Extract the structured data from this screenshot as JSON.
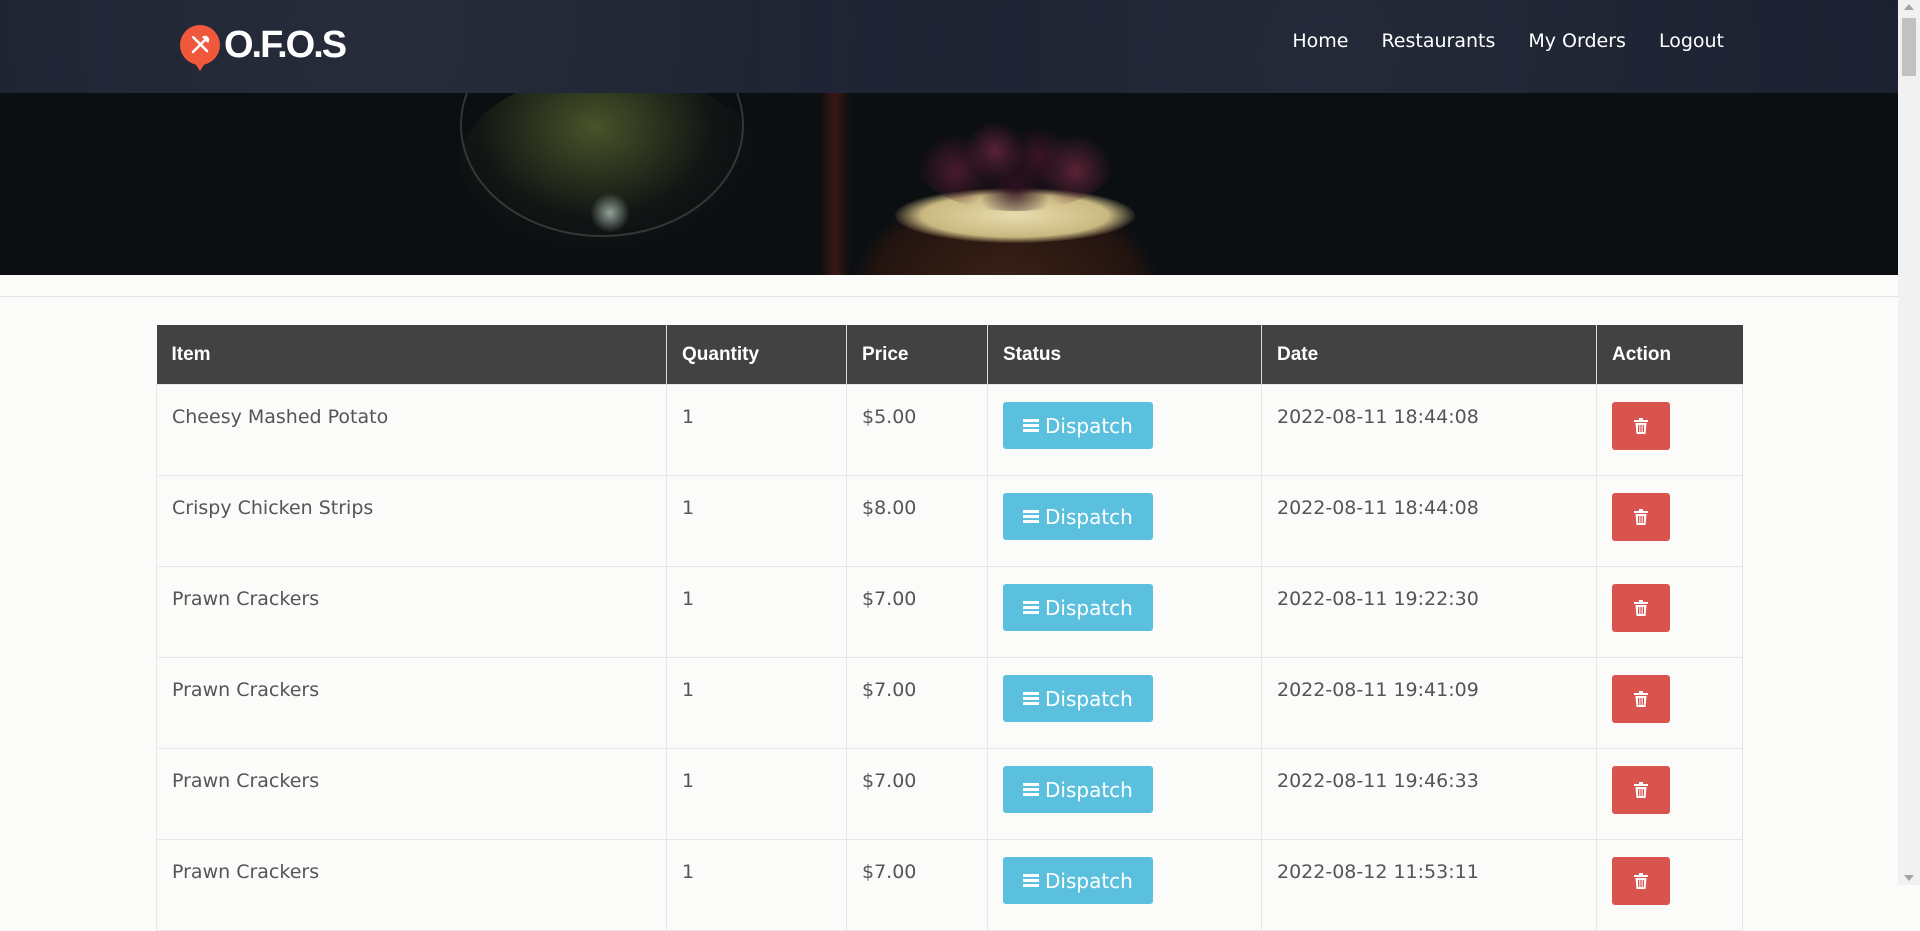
{
  "header": {
    "logo_text": "O.F.O.S",
    "nav": [
      "Home",
      "Restaurants",
      "My Orders",
      "Logout"
    ]
  },
  "table": {
    "columns": [
      "Item",
      "Quantity",
      "Price",
      "Status",
      "Date",
      "Action"
    ],
    "status_label": "Dispatch",
    "rows": [
      {
        "item": "Cheesy Mashed Potato",
        "quantity": "1",
        "price": "$5.00",
        "date": "2022-08-11 18:44:08"
      },
      {
        "item": "Crispy Chicken Strips",
        "quantity": "1",
        "price": "$8.00",
        "date": "2022-08-11 18:44:08"
      },
      {
        "item": "Prawn Crackers",
        "quantity": "1",
        "price": "$7.00",
        "date": "2022-08-11 19:22:30"
      },
      {
        "item": "Prawn Crackers",
        "quantity": "1",
        "price": "$7.00",
        "date": "2022-08-11 19:41:09"
      },
      {
        "item": "Prawn Crackers",
        "quantity": "1",
        "price": "$7.00",
        "date": "2022-08-11 19:46:33"
      },
      {
        "item": "Prawn Crackers",
        "quantity": "1",
        "price": "$7.00",
        "date": "2022-08-12 11:53:11"
      }
    ]
  },
  "colors": {
    "navbar": "#1b2130",
    "header_row": "#424242",
    "dispatch": "#5bc0de",
    "delete": "#d9534f",
    "logo_accent": "#f0583c"
  },
  "icons": {
    "dispatch": "bars-icon",
    "delete": "trash-icon",
    "logo": "utensils-pin-icon"
  }
}
